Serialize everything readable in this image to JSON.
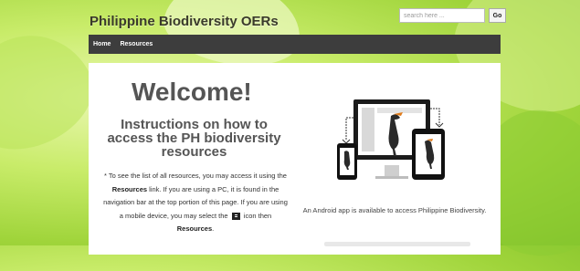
{
  "header": {
    "site_title": "Philippine Biodiversity OERs"
  },
  "search": {
    "placeholder": "search here ...",
    "button_label": "Go"
  },
  "nav": {
    "items": [
      {
        "label": "Home"
      },
      {
        "label": "Resources"
      }
    ]
  },
  "main": {
    "welcome": "Welcome!",
    "instructions_heading": "Instructions on how to access the PH biodiversity resources",
    "paragraph": {
      "part1": "* To see the list of all resources, you may access it using the ",
      "resources_link_text": "Resources",
      "part2": " link. If you are using a PC, it is found in the navigation bar at the top portion of this page. If you are using a mobile device, you may select the ",
      "part3": " icon then ",
      "resources_end": "Resources",
      "end": "."
    },
    "android_text": "An Android app is available to access Philippine Biodiversity."
  },
  "icons": {
    "menu": "menu-icon",
    "devices": "devices-illustration"
  }
}
